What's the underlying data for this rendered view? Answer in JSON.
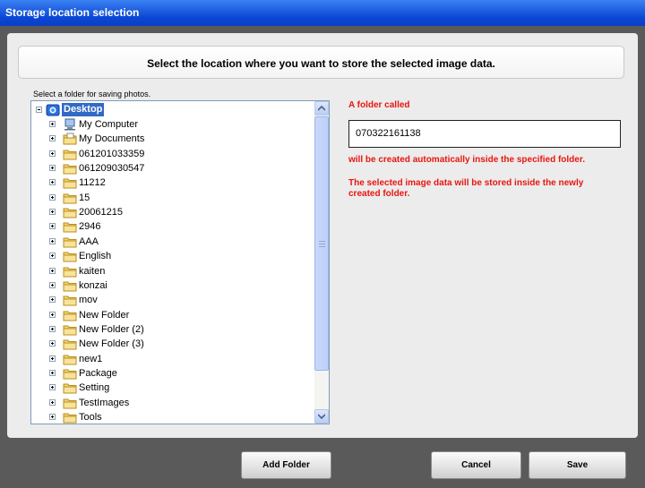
{
  "window": {
    "title": "Storage location selection"
  },
  "header": {
    "instruction": "Select the location where you want to store the selected image data."
  },
  "tree": {
    "label": "Select a folder for saving photos.",
    "root": {
      "label": "Desktop",
      "icon": "desktop-icon",
      "selected": true
    },
    "items": [
      {
        "label": "My Computer",
        "icon": "computer-icon"
      },
      {
        "label": "My Documents",
        "icon": "documents-icon"
      },
      {
        "label": "061201033359",
        "icon": "folder-icon"
      },
      {
        "label": "061209030547",
        "icon": "folder-icon"
      },
      {
        "label": "11212",
        "icon": "folder-icon"
      },
      {
        "label": "15",
        "icon": "folder-icon"
      },
      {
        "label": "20061215",
        "icon": "folder-icon"
      },
      {
        "label": "2946",
        "icon": "folder-icon"
      },
      {
        "label": "AAA",
        "icon": "folder-icon"
      },
      {
        "label": "English",
        "icon": "folder-icon"
      },
      {
        "label": "kaiten",
        "icon": "folder-icon"
      },
      {
        "label": "konzai",
        "icon": "folder-icon"
      },
      {
        "label": "mov",
        "icon": "folder-icon"
      },
      {
        "label": "New Folder",
        "icon": "folder-icon"
      },
      {
        "label": "New Folder (2)",
        "icon": "folder-icon"
      },
      {
        "label": "New Folder (3)",
        "icon": "folder-icon"
      },
      {
        "label": "new1",
        "icon": "folder-icon"
      },
      {
        "label": "Package",
        "icon": "folder-icon"
      },
      {
        "label": "Setting",
        "icon": "folder-icon"
      },
      {
        "label": "TestImages",
        "icon": "folder-icon"
      },
      {
        "label": "Tools",
        "icon": "folder-icon"
      }
    ]
  },
  "info": {
    "folder_called": "A folder called",
    "folder_name_value": "070322161138",
    "created_note": "will be created automatically inside the specified folder.",
    "stored_note": "The selected image data will be stored inside the newly created folder."
  },
  "buttons": {
    "add_folder": "Add Folder",
    "cancel": "Cancel",
    "save": "Save"
  },
  "colors": {
    "title_bar": "#0a46d4",
    "selection": "#316ac5",
    "notice_text": "#e8160f"
  }
}
